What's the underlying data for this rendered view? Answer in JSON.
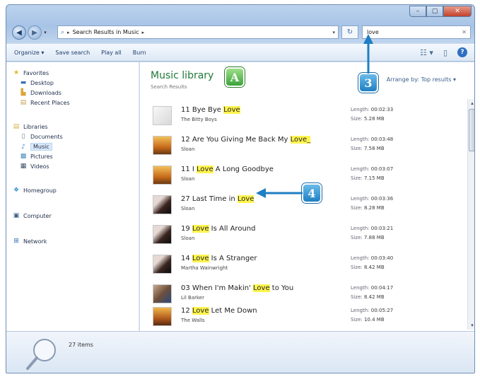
{
  "address": {
    "path": "Search Results in Music",
    "search_value": "love"
  },
  "toolbar": {
    "organize": "Organize ▾",
    "save_search": "Save search",
    "play_all": "Play all",
    "burn": "Burn"
  },
  "nav": {
    "favorites": "Favorites",
    "desktop": "Desktop",
    "downloads": "Downloads",
    "recent_places": "Recent Places",
    "libraries": "Libraries",
    "documents": "Documents",
    "music": "Music",
    "pictures": "Pictures",
    "videos": "Videos",
    "homegroup": "Homegroup",
    "computer": "Computer",
    "network": "Network"
  },
  "library": {
    "title": "Music library",
    "subtitle": "Search Results",
    "arrange_label": "Arrange by:",
    "arrange_value": "Top results ▾"
  },
  "results": [
    {
      "pre": "11 Bye Bye ",
      "hl": "Love",
      "post": "",
      "artist": "The Bitty Boys",
      "length": "00:02:33",
      "size": "5.28 MB"
    },
    {
      "pre": "12 Are You Giving Me Back My ",
      "hl": "Love_",
      "post": "",
      "artist": "Sloan",
      "length": "00:03:48",
      "size": "7.58 MB"
    },
    {
      "pre": "11 I ",
      "hl": "Love",
      "post": " A Long Goodbye",
      "artist": "Sloan",
      "length": "00:03:07",
      "size": "7.15 MB"
    },
    {
      "pre": "27 Last Time in ",
      "hl": "Love",
      "post": "",
      "artist": "Sloan",
      "length": "00:03:36",
      "size": "8.28 MB"
    },
    {
      "pre": "19 ",
      "hl": "Love",
      "post": " Is All Around",
      "artist": "Sloan",
      "length": "00:03:21",
      "size": "7.88 MB"
    },
    {
      "pre": "14 ",
      "hl": "Love",
      "post": " Is A Stranger",
      "artist": "Martha Wainwright",
      "length": "00:03:40",
      "size": "8.42 MB"
    },
    {
      "pre": "03 When I'm Makin' ",
      "hl": "Love",
      "post": " to You",
      "artist": "Lil Barker",
      "length": "00:04:17",
      "size": "8.42 MB"
    },
    {
      "pre": "12 ",
      "hl": "Love",
      "post": " Let Me Down",
      "artist": "The Walls",
      "length": "00:05:27",
      "size": "10.4 MB"
    }
  ],
  "labels": {
    "length": "Length:",
    "size": "Size:"
  },
  "details": {
    "count": "27 items"
  },
  "callouts": {
    "a": "A",
    "three": "3",
    "four": "4"
  },
  "colors": {
    "highlight": "#fff44f",
    "library_title": "#1f7a3a",
    "callout_blue": "#1f7fc4",
    "callout_green": "#3aa339"
  }
}
